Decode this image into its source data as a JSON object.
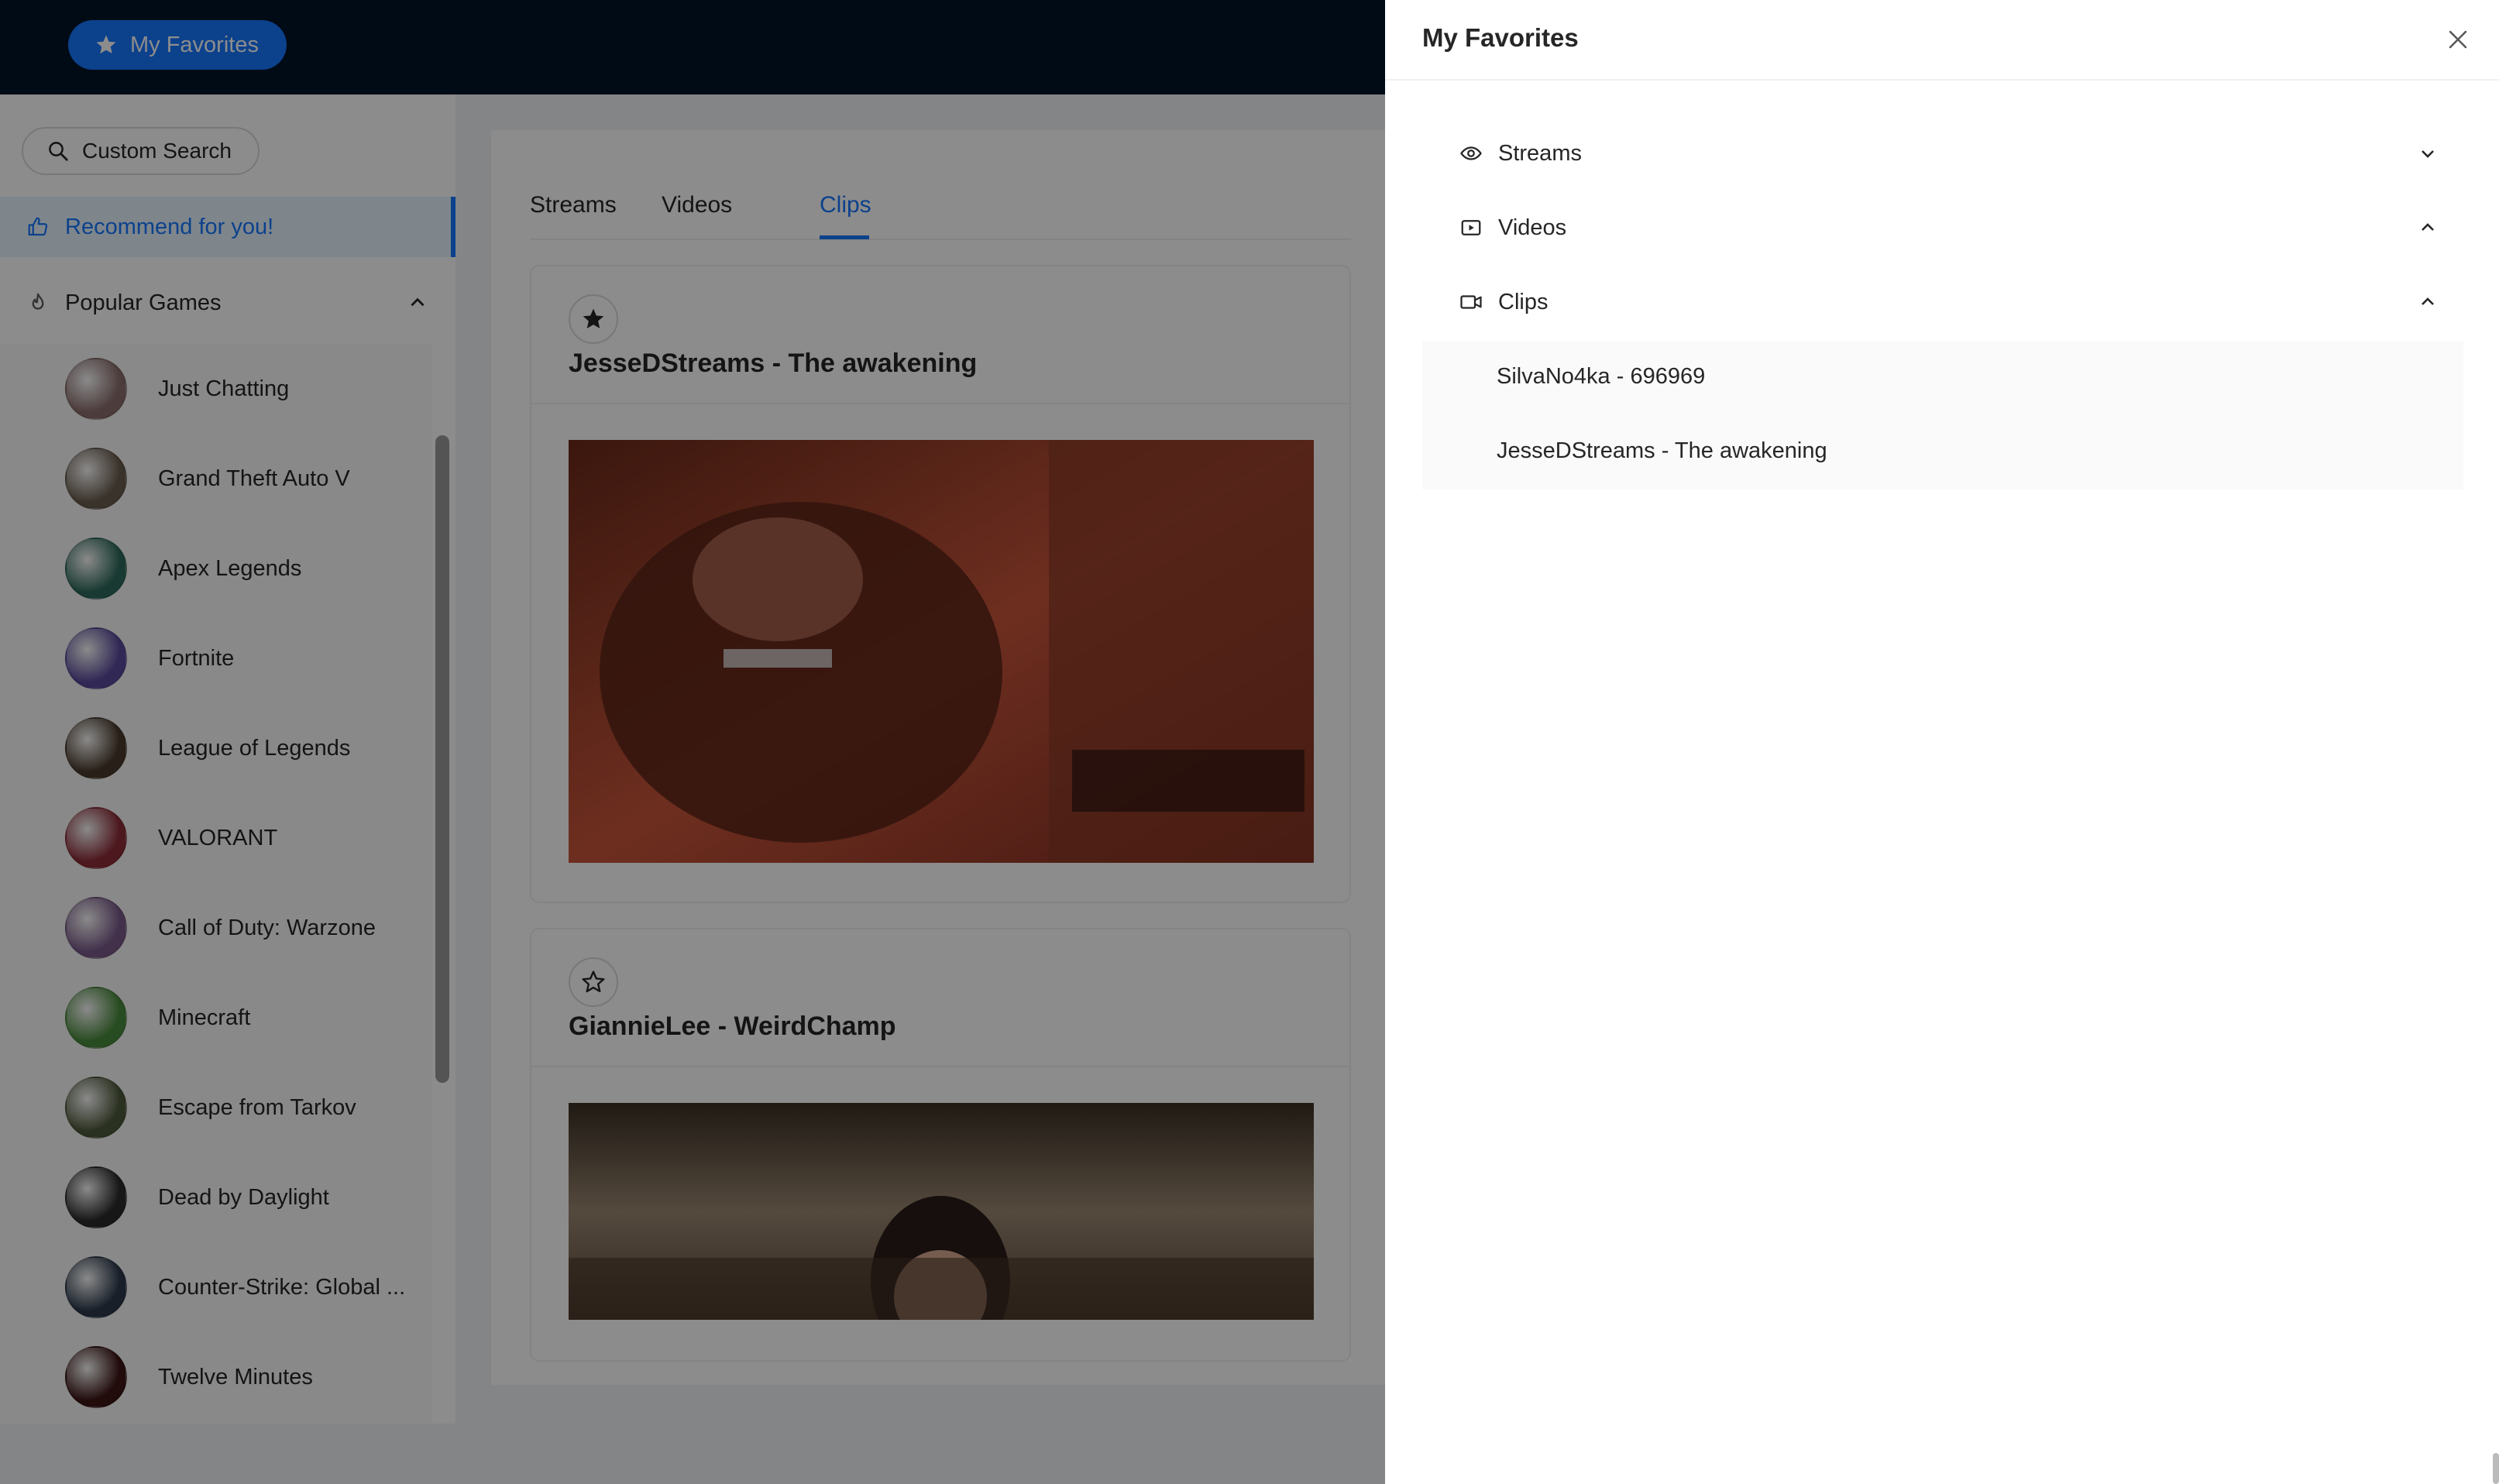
{
  "header": {
    "favorites_button_label": "My Favorites"
  },
  "sidebar": {
    "search_label": "Custom Search",
    "recommend_label": "Recommend for you!",
    "popular_label": "Popular Games",
    "games": [
      {
        "name": "Just Chatting",
        "color": "#8b6d6d"
      },
      {
        "name": "Grand Theft Auto V",
        "color": "#6b5d4f"
      },
      {
        "name": "Apex Legends",
        "color": "#2f6b5c"
      },
      {
        "name": "Fortnite",
        "color": "#5a4a9c"
      },
      {
        "name": "League of Legends",
        "color": "#4a3a2c"
      },
      {
        "name": "VALORANT",
        "color": "#8c2c38"
      },
      {
        "name": "Call of Duty: Warzone",
        "color": "#7a5a8a"
      },
      {
        "name": "Minecraft",
        "color": "#4a8a3c"
      },
      {
        "name": "Escape from Tarkov",
        "color": "#4f5a3c"
      },
      {
        "name": "Dead by Daylight",
        "color": "#2a2a2a"
      },
      {
        "name": "Counter-Strike: Global ...",
        "color": "#2c3a4c"
      },
      {
        "name": "Twelve Minutes",
        "color": "#3c1414"
      }
    ]
  },
  "main": {
    "tabs": [
      "Streams",
      "Videos",
      "Clips"
    ],
    "active_tab": "Clips",
    "cards": [
      {
        "title": "JesseDStreams - The awakening",
        "favorited": true
      },
      {
        "title": "GiannieLee - WeirdChamp",
        "favorited": false
      }
    ]
  },
  "drawer": {
    "title": "My Favorites",
    "sections": [
      {
        "label": "Streams",
        "icon": "eye-icon",
        "expanded": false
      },
      {
        "label": "Videos",
        "icon": "video-play-icon",
        "expanded": true
      },
      {
        "label": "Clips",
        "icon": "camera-icon",
        "expanded": true
      }
    ],
    "clips": [
      "SilvaNo4ka - 696969",
      "JesseDStreams - The awakening"
    ]
  },
  "colors": {
    "header_bg": "#001529",
    "accent": "#1677ff",
    "overlay": "rgba(0,0,0,0.45)"
  }
}
